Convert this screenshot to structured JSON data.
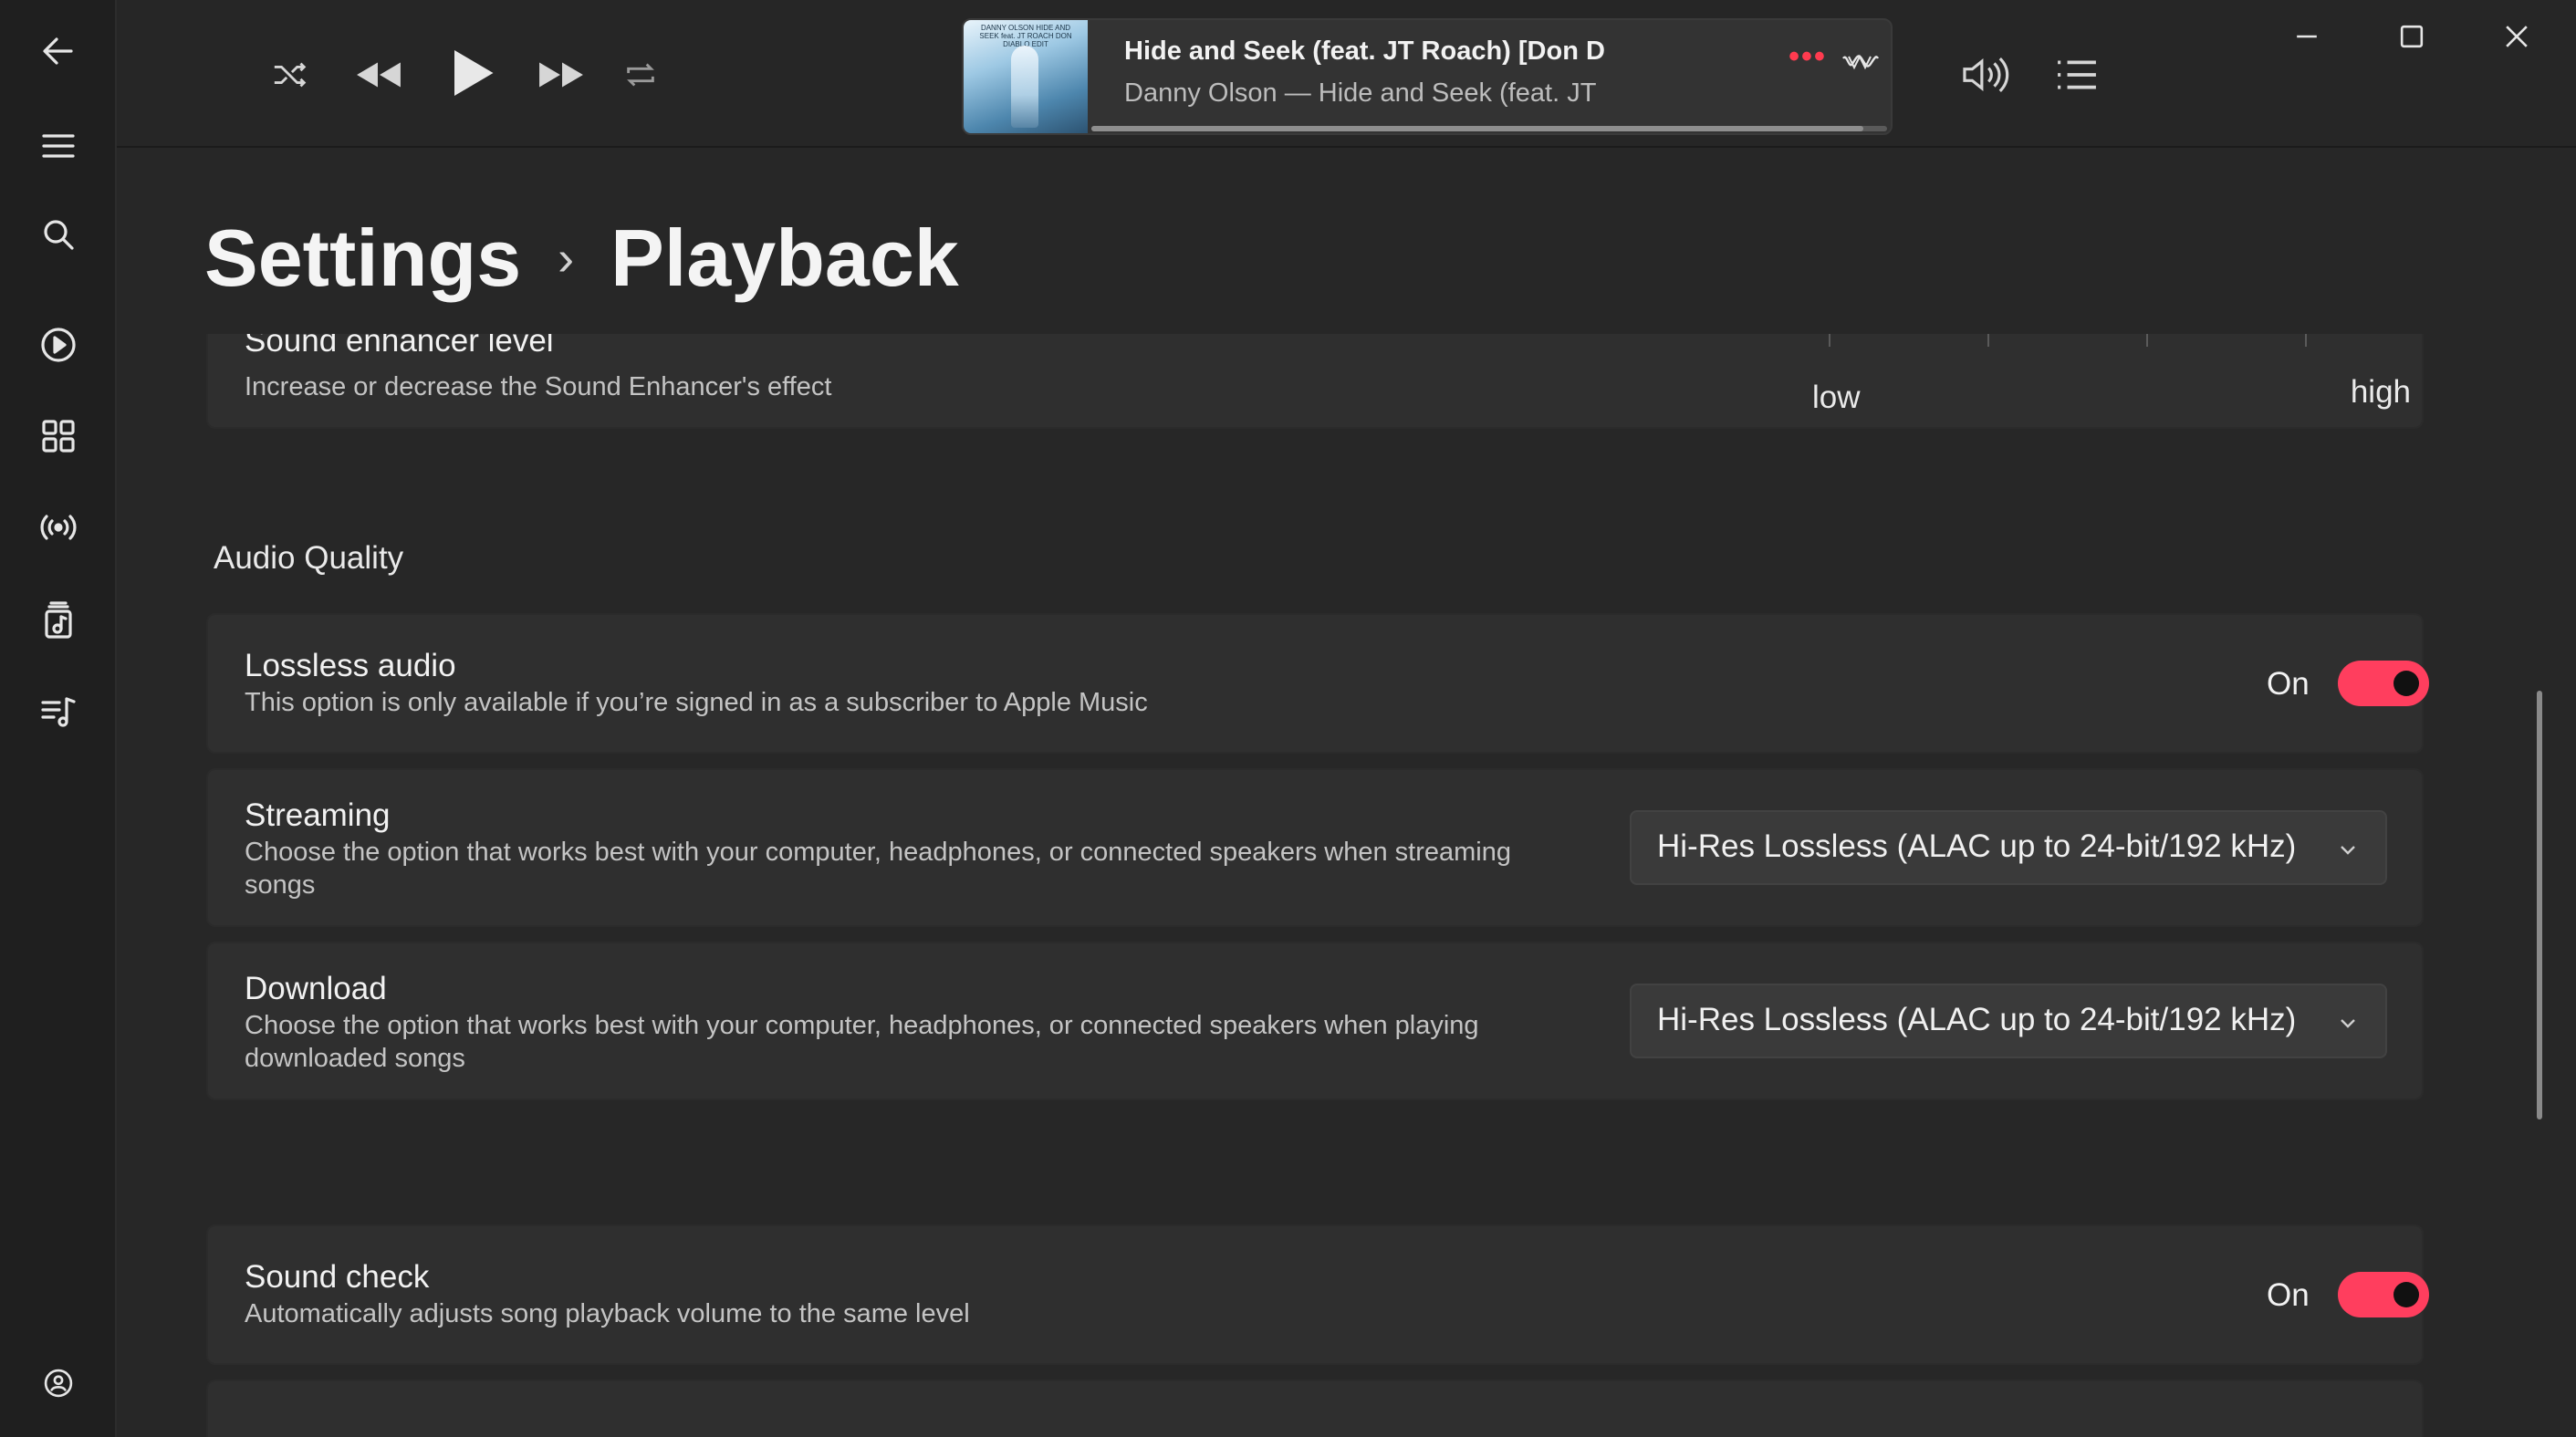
{
  "window": {
    "minimize_icon": "minimize-icon",
    "maximize_icon": "maximize-icon",
    "close_icon": "close-icon"
  },
  "sidebar": {
    "items": [
      {
        "icon": "back-arrow-icon"
      },
      {
        "icon": "hamburger-menu-icon"
      },
      {
        "icon": "search-icon"
      },
      {
        "icon": "listen-now-icon"
      },
      {
        "icon": "browse-grid-icon"
      },
      {
        "icon": "radio-icon"
      },
      {
        "icon": "library-icon"
      },
      {
        "icon": "playlist-icon"
      },
      {
        "icon": "account-icon"
      }
    ]
  },
  "player": {
    "controls": [
      "shuffle-icon",
      "previous-icon",
      "play-icon",
      "next-icon",
      "repeat-icon"
    ],
    "now_playing": {
      "title": "Hide and Seek (feat. JT Roach) [Don D",
      "subtitle": "Danny Olson — Hide and Seek (feat. JT",
      "artwork_text": "DANNY OLSON HIDE AND SEEK feat. JT ROACH DON DIABLO EDIT",
      "more": "•••",
      "progress": 0.97
    },
    "volume_icon": "volume-icon",
    "queue_icon": "queue-list-icon"
  },
  "breadcrumb": {
    "root": "Settings",
    "separator": "›",
    "current": "Playback"
  },
  "sound_enhancer": {
    "title": "Sound enhancer level",
    "description": "Increase or decrease the Sound Enhancer's effect",
    "low_label": "low",
    "high_label": "high"
  },
  "audio_quality": {
    "section_title": "Audio Quality",
    "lossless": {
      "title": "Lossless audio",
      "description": "This option is only available if you’re signed in as a subscriber to Apple Music",
      "state": "On"
    },
    "streaming": {
      "title": "Streaming",
      "description": "Choose the option that works best with your computer, headphones, or connected speakers when streaming songs",
      "value": "Hi-Res Lossless (ALAC up to 24-bit/192 kHz)"
    },
    "download": {
      "title": "Download",
      "description": "Choose the option that works best with your computer, headphones, or connected speakers when playing downloaded songs",
      "value": "Hi-Res Lossless (ALAC up to 24-bit/192 kHz)"
    }
  },
  "sound_check": {
    "title": "Sound check",
    "description": "Automatically adjusts song playback volume to the same level",
    "state": "On"
  },
  "colors": {
    "accent": "#ff3e5e",
    "background": "#272727",
    "card": "#2f2f2f"
  }
}
